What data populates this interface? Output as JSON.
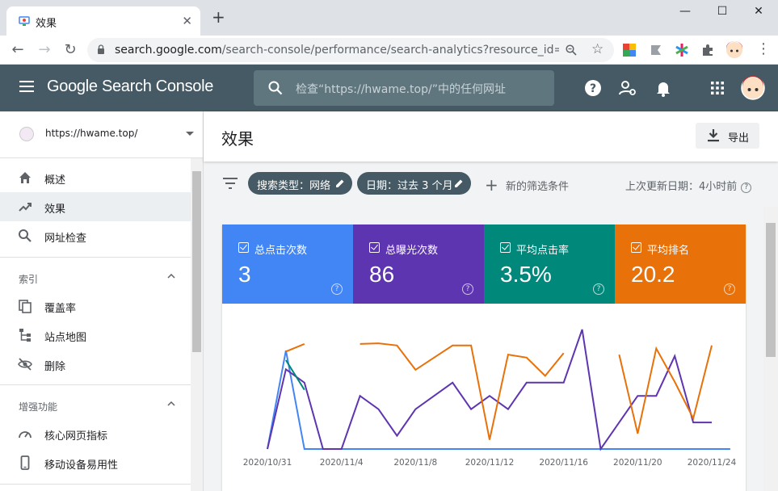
{
  "browser": {
    "tab_title": "效果",
    "url_host": "search.google.com",
    "url_path": "/search-console/performance/search-analytics?resource_id=..."
  },
  "header": {
    "logo": "Google Search Console",
    "search_placeholder": "检查“https://hwame.top/”中的任何网址"
  },
  "sidebar": {
    "property": "https://hwame.top/",
    "items": [
      {
        "label": "概述",
        "icon": "home-icon"
      },
      {
        "label": "效果",
        "icon": "trending-up-icon"
      },
      {
        "label": "网址检查",
        "icon": "search-icon"
      }
    ],
    "sections": [
      {
        "title": "索引",
        "items": [
          {
            "label": "覆盖率",
            "icon": "copy-icon"
          },
          {
            "label": "站点地图",
            "icon": "sitemap-icon"
          },
          {
            "label": "删除",
            "icon": "eye-off-icon"
          }
        ]
      },
      {
        "title": "增强功能",
        "items": [
          {
            "label": "核心网页指标",
            "icon": "speed-icon"
          },
          {
            "label": "移动设备易用性",
            "icon": "phone-icon"
          }
        ]
      }
    ]
  },
  "main": {
    "title": "效果",
    "export_label": "导出",
    "filters": [
      {
        "label": "搜索类型：网络"
      },
      {
        "label": "日期：过去 3 个月"
      }
    ],
    "add_filter_label": "新的筛选条件",
    "last_updated": "上次更新日期：4小时前"
  },
  "metrics": [
    {
      "label": "总点击次数",
      "value": "3",
      "color": "#4285f4"
    },
    {
      "label": "总曝光次数",
      "value": "86",
      "color": "#5e35b1"
    },
    {
      "label": "平均点击率",
      "value": "3.5%",
      "color": "#00897b"
    },
    {
      "label": "平均排名",
      "value": "20.2",
      "color": "#e8710a"
    }
  ],
  "chart_data": {
    "type": "line",
    "x_tick_labels": [
      "2020/10/31",
      "2020/11/4",
      "2020/11/8",
      "2020/11/12",
      "2020/11/16",
      "2020/11/20",
      "2020/11/24"
    ],
    "x_days": 25,
    "series": [
      {
        "name": "总点击次数",
        "color": "#4285f4",
        "values": [
          0,
          1,
          0,
          0,
          0,
          0,
          0,
          0,
          0,
          0,
          0,
          0,
          0,
          0,
          0,
          0,
          0,
          0,
          0,
          0,
          0,
          0,
          0,
          0,
          0,
          0
        ]
      },
      {
        "name": "总曝光次数",
        "color": "#5e35b1",
        "values": [
          0,
          6,
          5,
          0,
          0,
          4,
          3,
          1,
          3,
          4,
          5,
          3,
          4,
          3,
          5,
          5,
          5,
          9,
          0,
          2,
          4,
          4,
          7,
          2,
          2
        ]
      },
      {
        "name": "平均点击率",
        "color": "#00897b",
        "values": [
          null,
          50,
          33.3,
          null,
          null,
          null,
          null,
          null,
          null,
          null,
          null,
          null,
          null,
          null,
          null,
          null,
          null,
          null,
          null,
          null,
          null,
          null,
          null,
          null,
          null
        ]
      },
      {
        "name": "平均排名",
        "color": "#e8710a",
        "values": [
          null,
          7,
          4.5,
          null,
          null,
          4.5,
          4.3,
          5,
          13,
          9,
          5,
          5,
          36,
          8,
          9,
          15,
          7.5,
          null,
          null,
          8,
          34,
          6,
          17,
          29,
          5
        ]
      }
    ]
  }
}
